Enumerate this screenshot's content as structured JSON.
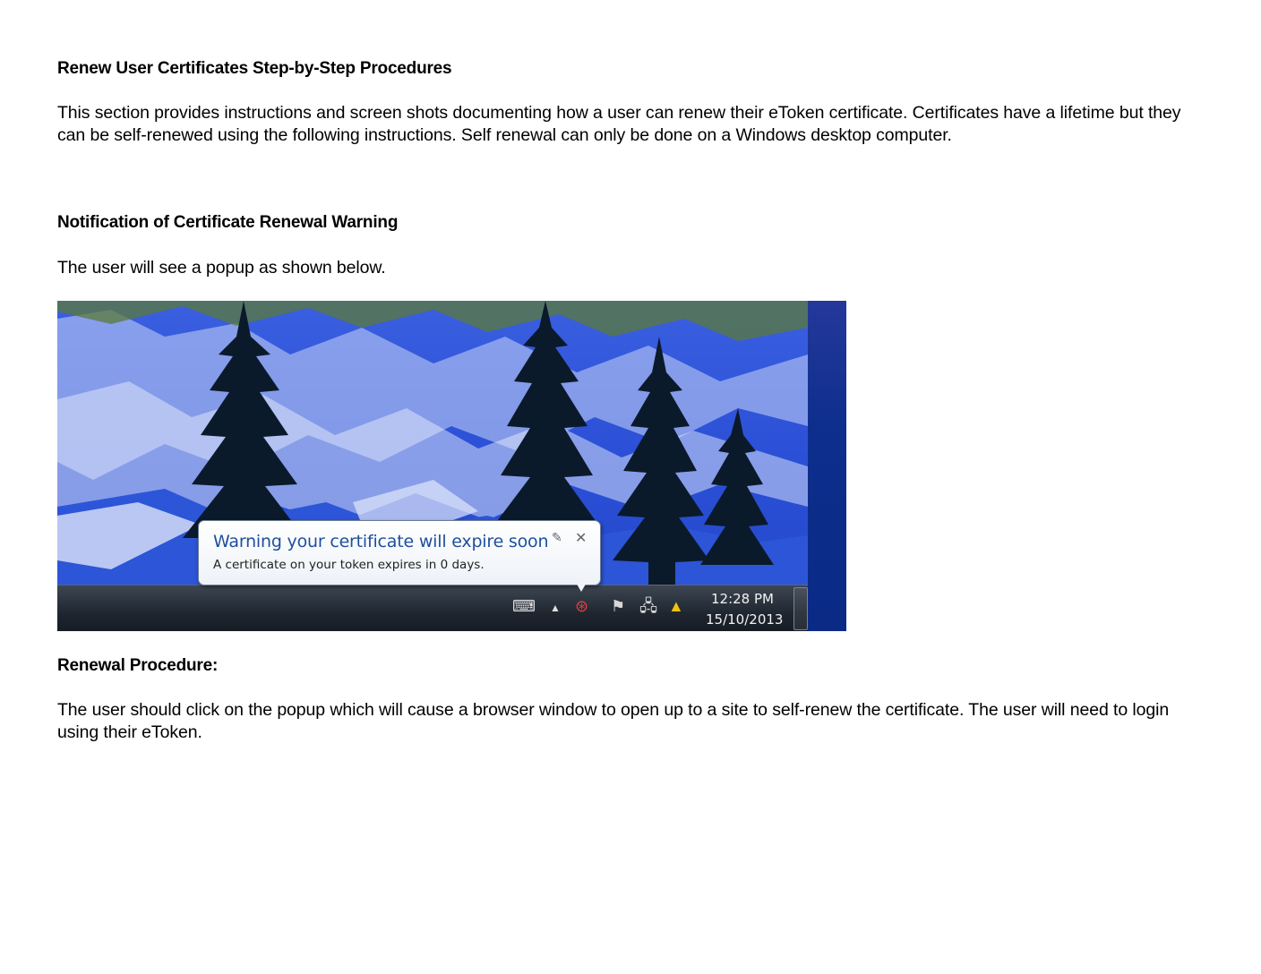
{
  "document": {
    "heading_1": "Renew User Certificates Step-by-Step Procedures",
    "intro_paragraph": "This section provides instructions and screen shots documenting how a user can renew their eToken certificate. Certificates have a lifetime but they can be self-renewed using the following instructions. Self renewal can only be done on a Windows desktop computer.",
    "heading_2": "Notification of Certificate Renewal Warning",
    "popup_intro": "The user will see a popup as shown below.",
    "heading_3": "Renewal Procedure:",
    "renewal_paragraph": "The user should click on the popup which will cause a browser window to open up to a site to self-renew the certificate. The user will need to login using their eToken."
  },
  "screenshot": {
    "popup": {
      "title": "Warning your certificate will expire soon",
      "message": "A certificate on your token expires in 0 days.",
      "close_glyph": "✕",
      "pin_glyph": "✎"
    },
    "taskbar": {
      "time": "12:28 PM",
      "date": "15/10/2013",
      "tray_icons": [
        "keyboard-icon",
        "show-hidden-icons-arrow",
        "etoken-icon",
        "action-center-flag-icon",
        "network-icon",
        "google-drive-icon"
      ]
    }
  }
}
